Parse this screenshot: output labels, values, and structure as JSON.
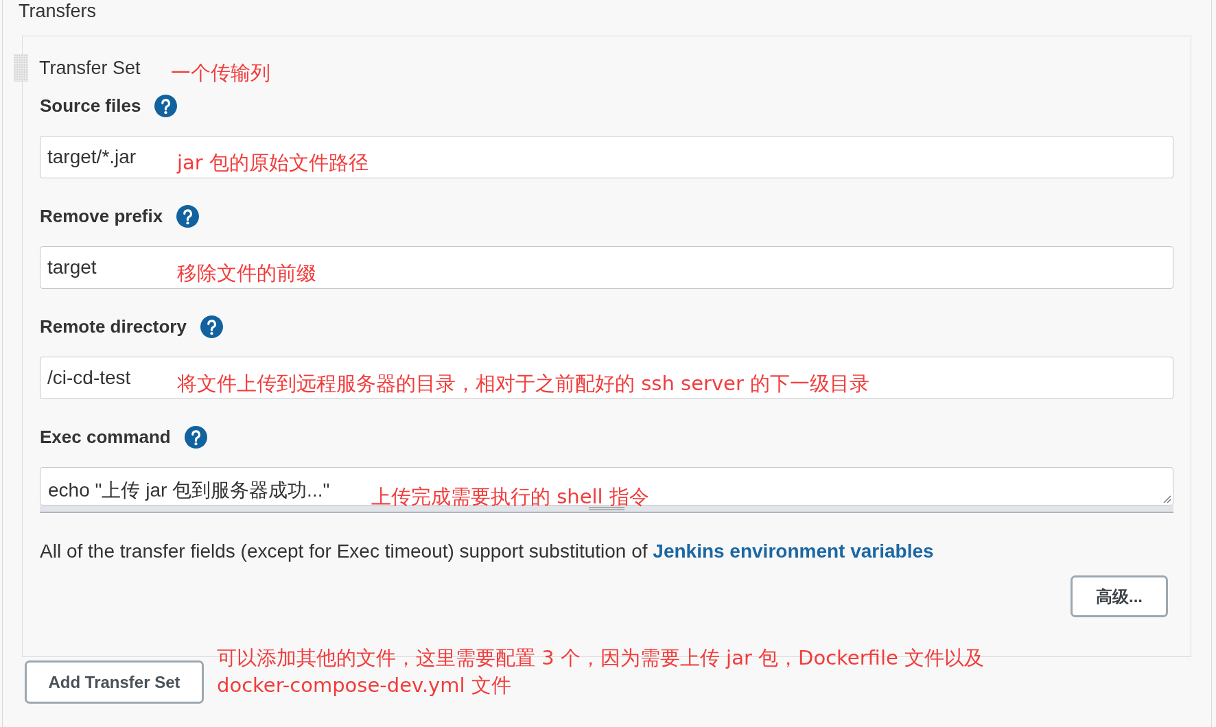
{
  "section": {
    "title": "Transfers"
  },
  "transfer_set": {
    "title": "Transfer Set",
    "title_annotation": "一个传输列",
    "fields": [
      {
        "kind": "input",
        "label": "Source files",
        "value": "target/*.jar",
        "annotation": "jar 包的原始文件路径"
      },
      {
        "kind": "input",
        "label": "Remove prefix",
        "value": "target",
        "annotation": "移除文件的前缀"
      },
      {
        "kind": "input",
        "label": "Remote directory",
        "value": "/ci-cd-test",
        "annotation": "将文件上传到远程服务器的目录，相对于之前配好的 ssh server 的下一级目录"
      },
      {
        "kind": "textarea",
        "label": "Exec command",
        "value": "echo \"上传 jar 包到服务器成功...\"",
        "annotation": "上传完成需要执行的 shell 指令"
      }
    ],
    "note": {
      "text": "All of the transfer fields (except for Exec timeout) support substitution of",
      "link": "Jenkins environment variables"
    },
    "advanced_button": "高级..."
  },
  "add_button": {
    "label": "Add Transfer Set",
    "annotation": "可以添加其他的文件，这里需要配置 3 个，因为需要上传 jar 包，Dockerfile 文件以及\ndocker-compose-dev.yml 文件"
  }
}
